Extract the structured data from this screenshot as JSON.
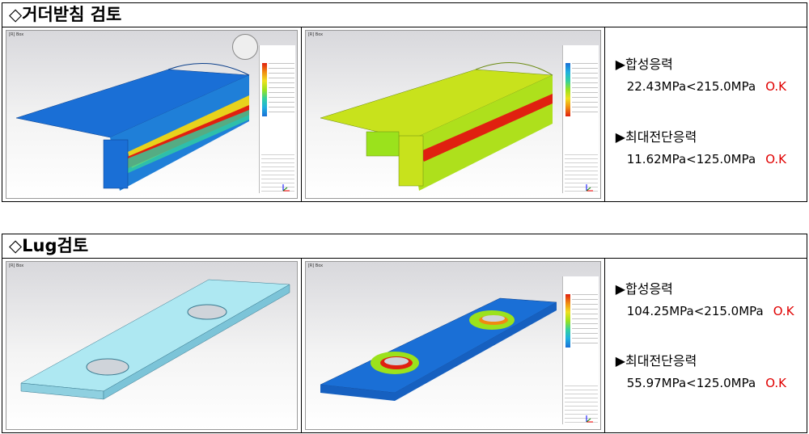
{
  "sections": [
    {
      "title": "◇거더받침 검토",
      "images": [
        {
          "toolbar": "[R] Box"
        },
        {
          "toolbar": "[R] Box"
        }
      ],
      "results": [
        {
          "label": "▶합성응력",
          "value": "22.43MPa<215.0MPa",
          "status": "O.K"
        },
        {
          "label": "▶최대전단응력",
          "value": "11.62MPa<125.0MPa",
          "status": "O.K"
        }
      ]
    },
    {
      "title": "◇Lug검토",
      "images": [
        {
          "toolbar": "[R] Box"
        },
        {
          "toolbar": "[R] Box"
        }
      ],
      "results": [
        {
          "label": "▶합성응력",
          "value": "104.25MPa<215.0MPa",
          "status": "O.K"
        },
        {
          "label": "▶최대전단응력",
          "value": "55.97MPa<125.0MPa",
          "status": "O.K"
        }
      ]
    }
  ],
  "colors": {
    "ok": "#e00000",
    "mesh_blue": "#1a6fd6",
    "mesh_green": "#9be21c",
    "mesh_red": "#e02010",
    "plate_cyan": "#aee8f2"
  }
}
